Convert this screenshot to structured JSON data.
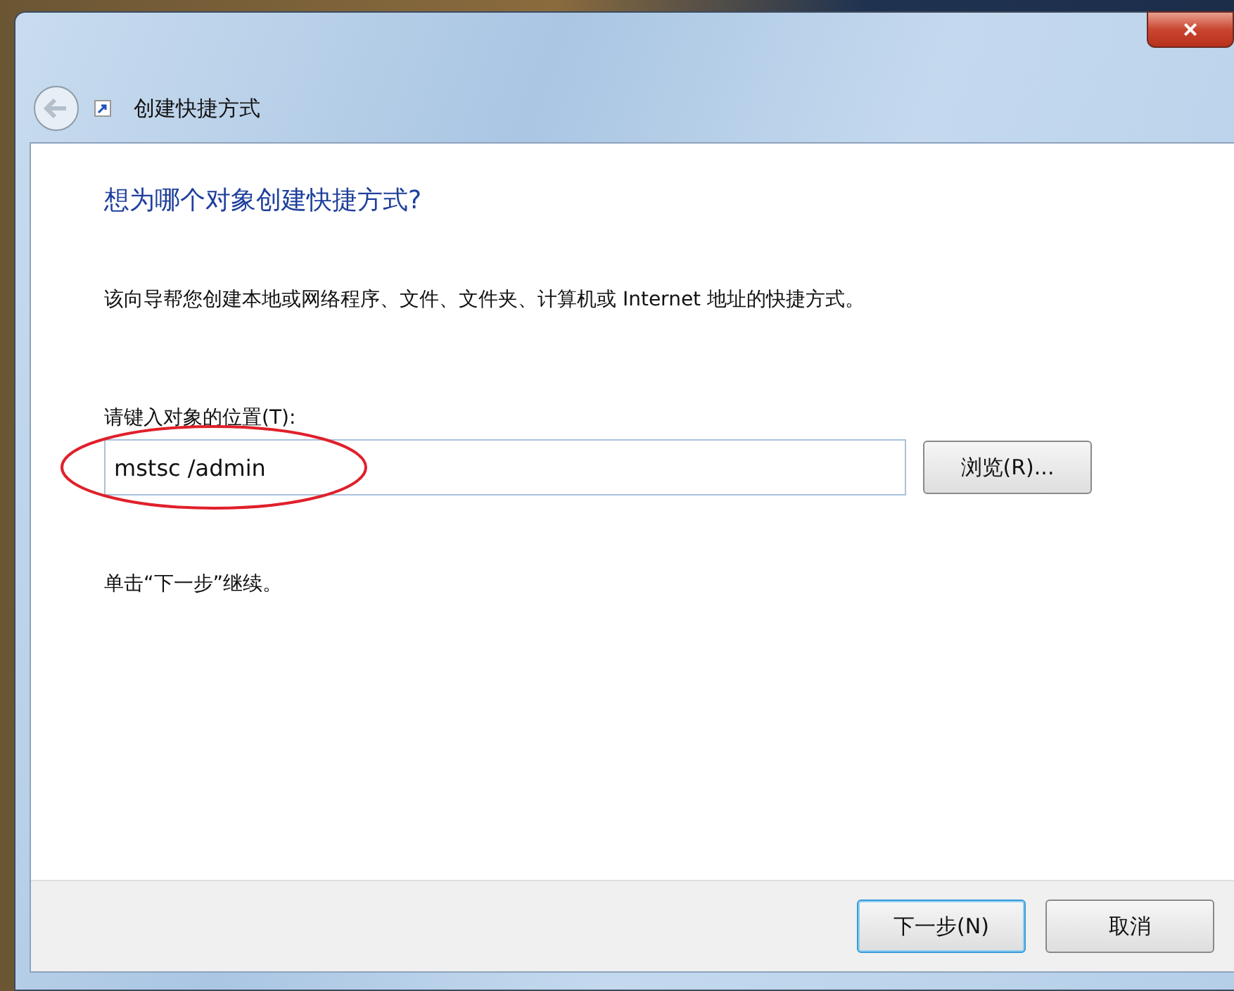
{
  "window": {
    "title": "创建快捷方式",
    "close": "×"
  },
  "heading": "想为哪个对象创建快捷方式?",
  "description": "该向导帮您创建本地或网络程序、文件、文件夹、计算机或 Internet 地址的快捷方式。",
  "location": {
    "label": "请键入对象的位置(T):",
    "value": "mstsc /admin",
    "browse": "浏览(R)...",
    "highlighted": true
  },
  "hint": "单击“下一步”继续。",
  "buttons": [
    {
      "label": "下一步(N)",
      "default": true
    },
    {
      "label": "取消",
      "default": false
    }
  ]
}
